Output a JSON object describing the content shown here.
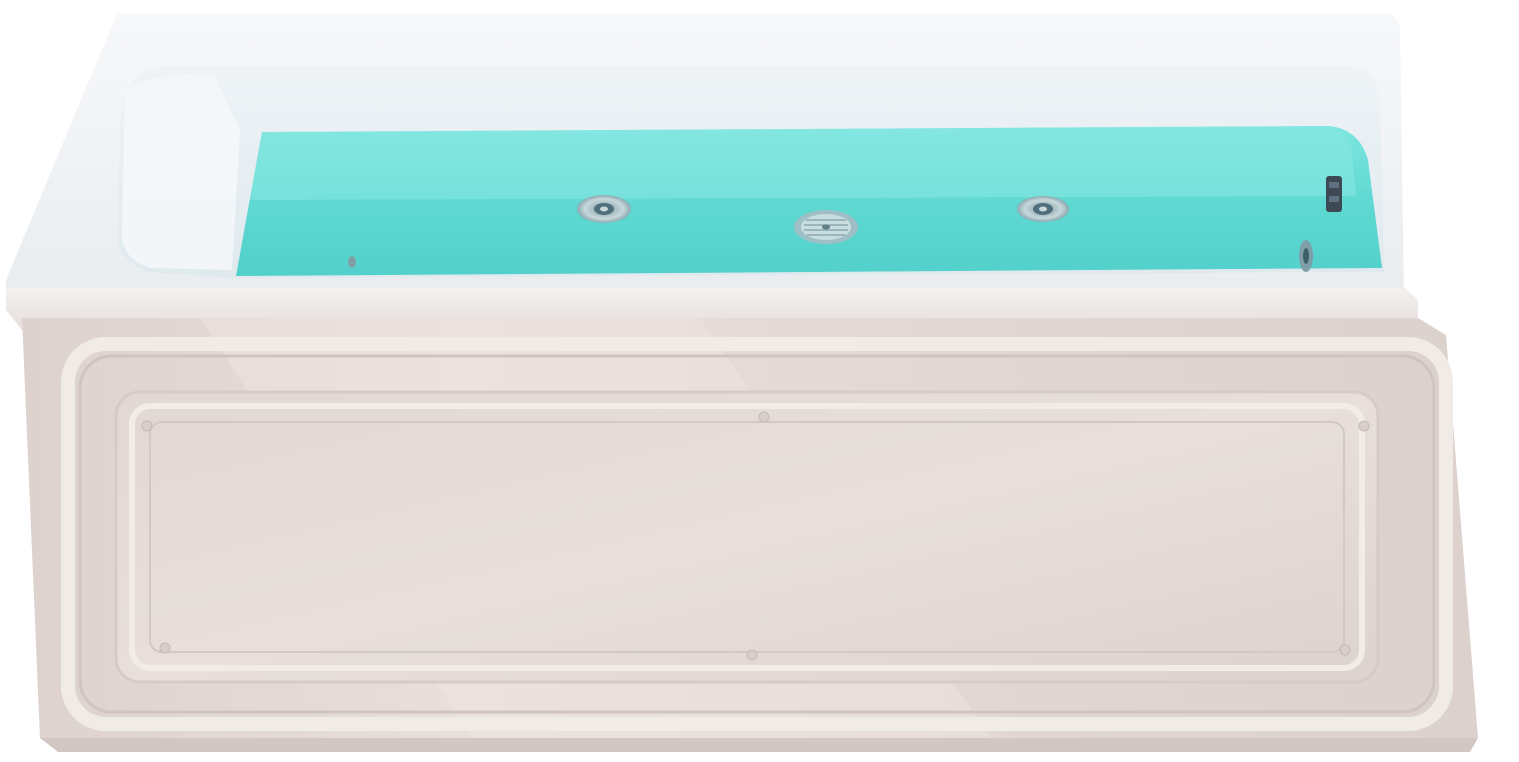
{
  "image": {
    "subject": "bathtub",
    "colors": {
      "background": "#ffffff",
      "acrylic": "#f4f1ef",
      "apron": "#e6dcd7",
      "water": "#5fd9d2",
      "water_deep": "#3ec4c0",
      "jet_ring": "#b9c9cc",
      "jet_center": "#4f6f7c",
      "control": "#3d4a56"
    }
  }
}
